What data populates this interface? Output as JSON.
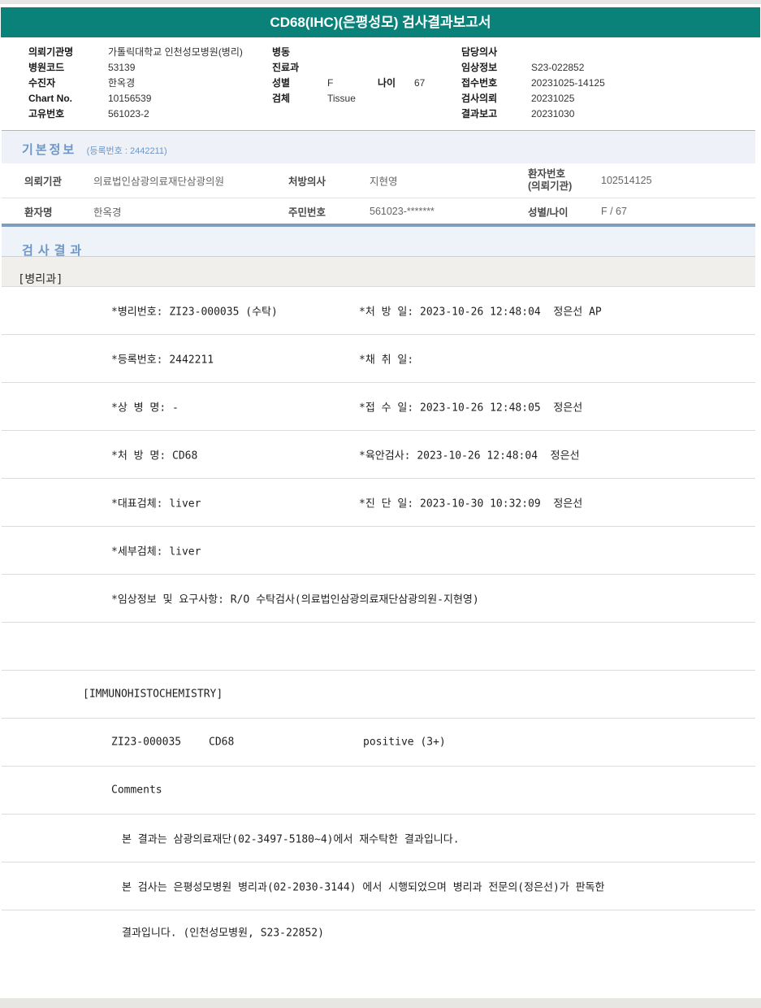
{
  "title": "CD68(IHC)(은평성모) 검사결과보고서",
  "colors": {
    "header_teal": "#0a8179",
    "section_heading_blue": "#6e96c6",
    "section_bg": "#eef2f8",
    "table_bottom_divider_blue": "#7f9dc2",
    "department_row_bg": "#f0efec"
  },
  "patient_info": {
    "left": [
      {
        "label": "의뢰기관명",
        "value": "가톨릭대학교 인천성모병원(병리)"
      },
      {
        "label": "병원코드",
        "value": "53139"
      },
      {
        "label": "수진자",
        "value": "한옥경"
      },
      {
        "label": "Chart No.",
        "value": "10156539"
      },
      {
        "label": "고유번호",
        "value": "561023-2"
      }
    ],
    "middle": {
      "ward_label": "병동",
      "ward": "",
      "dept_label": "진료과",
      "dept": "",
      "sex_label": "성별",
      "sex": "F",
      "age_label": "나이",
      "age": "67",
      "specimen_label": "검체",
      "specimen": "Tissue"
    },
    "right": [
      {
        "label": "담당의사",
        "value": ""
      },
      {
        "label": "임상정보",
        "value": "S23-022852"
      },
      {
        "label": "접수번호",
        "value": "20231025-14125"
      },
      {
        "label": "검사의뢰",
        "value": "20231025"
      },
      {
        "label": "결과보고",
        "value": "20231030"
      }
    ]
  },
  "basic_info": {
    "heading": "기본정보",
    "reg_note": "(등록번호 : 2442211)",
    "rows": [
      {
        "c1_label": "의뢰기관",
        "c1_value": "의료법인삼광의료재단삼광의원",
        "c2_label": "처방의사",
        "c2_value": "지현영",
        "c3_label": "환자번호\n(의뢰기관)",
        "c3_value": "102514125"
      },
      {
        "c1_label": "환자명",
        "c1_value": "한옥경",
        "c2_label": "주민번호",
        "c2_value": "561023-*******",
        "c3_label": "성별/나이",
        "c3_value": "F / 67"
      }
    ]
  },
  "results": {
    "heading": "검사결과",
    "department": "[병리과]",
    "rows": [
      {
        "left": "*병리번호: ZI23-000035 (수탁)",
        "right": "*처 방 일: 2023-10-26 12:48:04  정은선 AP"
      },
      {
        "left": "*등록번호: 2442211",
        "right": "*채 취 일:"
      },
      {
        "left": "*상 병 명: -",
        "right": "*접 수 일: 2023-10-26 12:48:05  정은선"
      },
      {
        "left": "*처 방 명: CD68",
        "right": "*육안검사: 2023-10-26 12:48:04  정은선"
      },
      {
        "left": "*대표검체: liver",
        "right": "*진 단 일: 2023-10-30 10:32:09  정은선"
      },
      {
        "left": "*세부검체: liver",
        "right": ""
      },
      {
        "left": "*임상정보 및 요구사항: R/O 수탁검사(의료법인삼광의료재단삼광의원-지현영)",
        "right": ""
      }
    ],
    "ihc_section_title": "[IMMUNOHISTOCHEMISTRY]",
    "ihc": {
      "specimen_no": "ZI23-000035",
      "test_name": "CD68",
      "result": "positive (3+)"
    },
    "comments_label": "Comments",
    "comments": [
      "본 결과는 삼광의료재단(02-3497-5180~4)에서 재수탁한 결과입니다.",
      "본 검사는 은평성모병원 병리과(02-2030-3144) 에서 시행되었으며 병리과 전문의(정은선)가 판독한",
      "결과입니다. (인천성모병원, S23-22852)"
    ]
  }
}
